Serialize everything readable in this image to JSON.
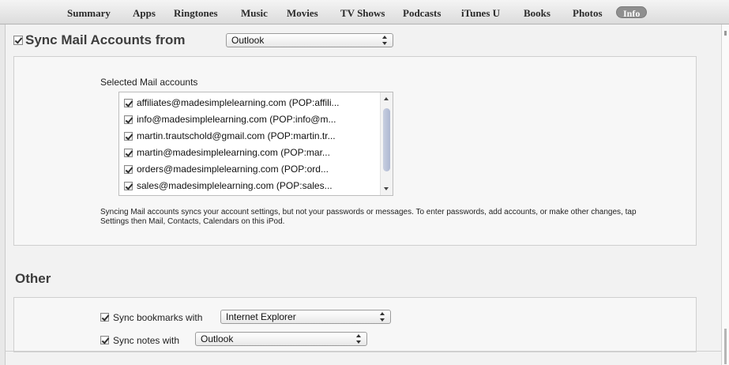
{
  "tabs": [
    {
      "label": "Summary"
    },
    {
      "label": "Apps"
    },
    {
      "label": "Ringtones"
    },
    {
      "label": "Music"
    },
    {
      "label": "Movies"
    },
    {
      "label": "TV Shows"
    },
    {
      "label": "Podcasts"
    },
    {
      "label": "iTunes U"
    },
    {
      "label": "Books"
    },
    {
      "label": "Photos"
    },
    {
      "label": "Info",
      "active": true
    }
  ],
  "mail": {
    "heading": "Sync Mail Accounts from",
    "source": "Outlook",
    "checked": true,
    "list_label": "Selected Mail accounts",
    "accounts": [
      {
        "label": "affiliates@madesimplelearning.com (POP:affili...",
        "checked": true
      },
      {
        "label": "info@madesimplelearning.com (POP:info@m...",
        "checked": true
      },
      {
        "label": "martin.trautschold@gmail.com (POP:martin.tr...",
        "checked": true
      },
      {
        "label": "martin@madesimplelearning.com (POP:mar...",
        "checked": true
      },
      {
        "label": "orders@madesimplelearning.com (POP:ord...",
        "checked": true
      },
      {
        "label": "sales@madesimplelearning.com (POP:sales...",
        "checked": true
      }
    ],
    "description": "Syncing Mail accounts syncs your account settings, but not your passwords or messages. To enter passwords, add accounts, or make other changes, tap Settings then Mail, Contacts, Calendars on this iPod."
  },
  "other": {
    "heading": "Other",
    "bookmarks_label": "Sync bookmarks with",
    "bookmarks_source": "Internet Explorer",
    "bookmarks_checked": true,
    "notes_label": "Sync notes with",
    "notes_source": "Outlook",
    "notes_checked": true
  }
}
